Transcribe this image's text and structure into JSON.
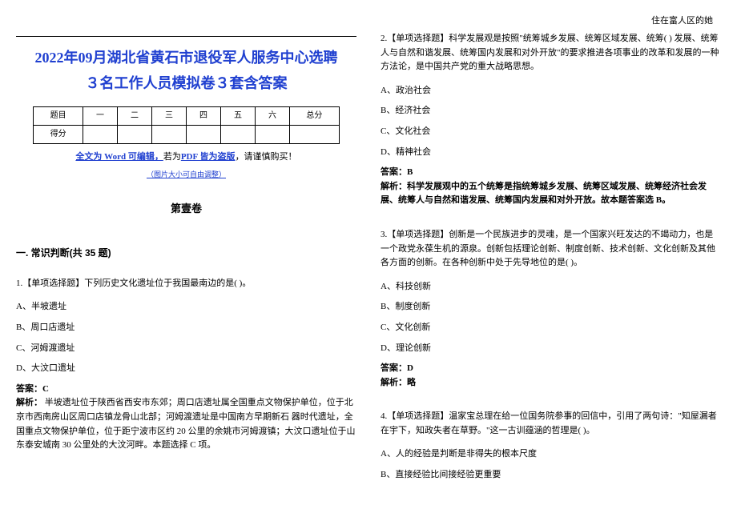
{
  "header_mark": "住在富人区的她",
  "title": "2022年09月湖北省黄石市退役军人服务中心选聘３名工作人员模拟卷３套含答案",
  "score_headers": [
    "题目",
    "一",
    "二",
    "三",
    "四",
    "五",
    "六",
    "总分"
  ],
  "score_row_label": "得分",
  "notice_prefix": "全文为 Word 可编辑，",
  "notice_mid": "若为",
  "notice_pdf": "PDF 皆为盗版",
  "notice_suffix": "，请谨慎购买！",
  "img_note": "（图片大小可自由调整）",
  "vol_title": "第壹卷",
  "section_title": "一. 常识判断(共 35 题)",
  "q1": {
    "stem": "1.【单项选择题】下列历史文化遗址位于我国最南边的是( )。",
    "opts": [
      "A、半坡遗址",
      "B、周口店遗址",
      "C、河姆渡遗址",
      "D、大汶口遗址"
    ],
    "ans_label": "答案：C",
    "analysis_label": "解析：",
    "analysis": "  半坡遗址位于陕西省西安市东郊；周口店遗址属全国重点文物保护单位，位于北京市西南房山区周口店镇龙骨山北部；河姆渡遗址是中国南方早期新石  器时代遗址，全国重点文物保护单位，位于距宁波市区约 20 公里的余姚市河姆渡镇；大汶口遗址位于山东泰安城南 30 公里处的大汶河畔。本题选择 C 项。"
  },
  "q2": {
    "stem": "2.【单项选择题】科学发展观是按照\"统筹城乡发展、统筹区域发展、统筹(    ) 发展、统筹人与自然和谐发展、统筹国内发展和对外开放\"的要求推进各项事业的改革和发展的一种方法论，是中国共产党的重大战略思想。",
    "opts": [
      "A、政治社会",
      "B、经济社会",
      "C、文化社会",
      "D、精神社会"
    ],
    "ans_label": "答案：B",
    "analysis_label": "解析：",
    "analysis": "科学发展观中的五个统筹是指统筹城乡发展、统筹区域发展、统筹经济社会发展、统筹人与自然和谐发展、统筹国内发展和对外开放。故本题答案选 B。"
  },
  "q3": {
    "stem": "3.【单项选择题】创新是一个民族进步的灵魂，是一个国家兴旺发达的不竭动力，也是一个政党永葆生机的源泉。创新包括理论创新、制度创新、技术创新、文化创新及其他各方面的创新。在各种创新中处于先导地位的是(   )。",
    "opts": [
      "A、科技创新",
      "B、制度创新",
      "C、文化创新",
      "D、理论创新"
    ],
    "ans_label": "答案：D",
    "analysis_label": "解析：",
    "analysis": "略"
  },
  "q4": {
    "stem": "4.【单项选择题】温家宝总理在给一位国务院参事的回信中，引用了两句诗：\"知屋漏者在宇下，知政失者在草野。\"这一古训蕴涵的哲理是(    )。",
    "opts": [
      "A、人的经验是判断是非得失的根本尺度",
      "B、直接经验比间接经验更重要"
    ]
  }
}
